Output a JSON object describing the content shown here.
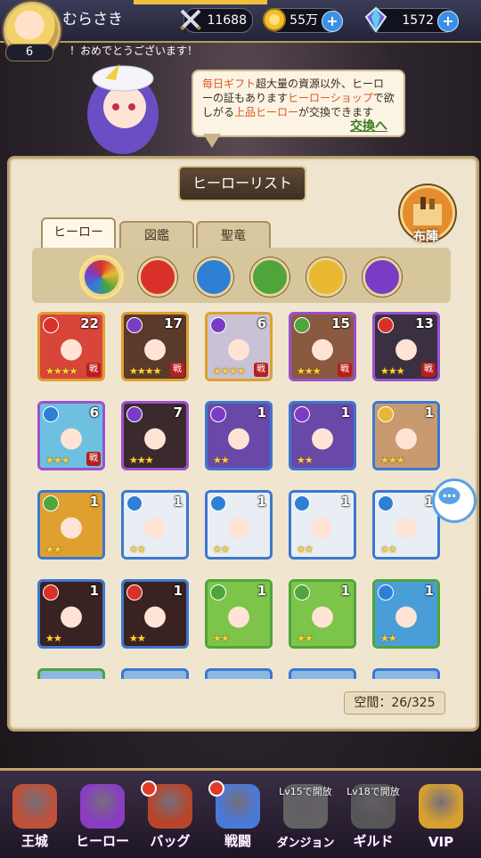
{
  "player": {
    "name": "むらさき",
    "level": "6",
    "power": "11688",
    "gold": "55万",
    "gems": "1572",
    "notice": "！おめでとうございます！"
  },
  "bubble": {
    "part1": "毎日ギフト",
    "part2": "超大量の資源以外、ヒーローの証もあります",
    "part3": "ヒーローショップ",
    "part4": "で欲しがる",
    "part5": "上品ヒーロー",
    "part6": "が交換できます",
    "link": "交換へ"
  },
  "panel": {
    "title": "ヒーローリスト",
    "tabs": [
      "ヒーロー",
      "図鑑",
      "聖竜"
    ],
    "formation": "布陣",
    "space": "空間：26/325"
  },
  "colors": {
    "accent": "#b9a172",
    "gold_star": "#ffd23a",
    "fire": "#d9302a",
    "water": "#2e7fd6",
    "wood": "#4fa43a",
    "light": "#e8b830",
    "dark": "#7a3cc4"
  },
  "filters": [
    "all",
    "fire",
    "water",
    "wood",
    "light",
    "dark"
  ],
  "heroes": [
    {
      "count": "22",
      "element": "fire",
      "stars": 4,
      "badge": "戦",
      "frame": "#e0a030",
      "art": "#d8463a"
    },
    {
      "count": "17",
      "element": "dark",
      "stars": 4,
      "badge": "戦",
      "frame": "#e0a030",
      "art": "#5a3a2a"
    },
    {
      "count": "6",
      "element": "dark",
      "stars": 4,
      "badge": "戦",
      "frame": "#e0a030",
      "art": "#c9c2d6"
    },
    {
      "count": "15",
      "element": "wood",
      "stars": 3,
      "badge": "戦",
      "frame": "#9b4fd0",
      "art": "#8a5a40"
    },
    {
      "count": "13",
      "element": "fire",
      "stars": 3,
      "badge": "戦",
      "frame": "#9b4fd0",
      "art": "#3a3040"
    },
    {
      "count": "6",
      "element": "water",
      "stars": 3,
      "badge": "戦",
      "frame": "#9b4fd0",
      "art": "#6ec0e0"
    },
    {
      "count": "7",
      "element": "dark",
      "stars": 3,
      "badge": "",
      "frame": "#9b4fd0",
      "art": "#3a2a2e"
    },
    {
      "count": "1",
      "element": "dark",
      "stars": 2,
      "badge": "",
      "frame": "#3b78d0",
      "art": "#6a48a8"
    },
    {
      "count": "1",
      "element": "dark",
      "stars": 2,
      "badge": "",
      "frame": "#3b78d0",
      "art": "#6a48a8"
    },
    {
      "count": "1",
      "element": "light",
      "stars": 3,
      "badge": "",
      "frame": "#3b78d0",
      "art": "#c89a70"
    },
    {
      "count": "1",
      "element": "wood",
      "stars": 2,
      "badge": "",
      "frame": "#3b78d0",
      "art": "#e0a030"
    },
    {
      "count": "1",
      "element": "water",
      "stars": 2,
      "badge": "",
      "frame": "#3b78d0",
      "art": "#e8eef4"
    },
    {
      "count": "1",
      "element": "water",
      "stars": 2,
      "badge": "",
      "frame": "#3b78d0",
      "art": "#e8eef4"
    },
    {
      "count": "1",
      "element": "water",
      "stars": 2,
      "badge": "",
      "frame": "#3b78d0",
      "art": "#e8eef4"
    },
    {
      "count": "1",
      "element": "water",
      "stars": 2,
      "badge": "",
      "frame": "#3b78d0",
      "art": "#e8eef4"
    },
    {
      "count": "1",
      "element": "fire",
      "stars": 2,
      "badge": "",
      "frame": "#3b78d0",
      "art": "#3a2222"
    },
    {
      "count": "1",
      "element": "fire",
      "stars": 2,
      "badge": "",
      "frame": "#3b78d0",
      "art": "#3a2222"
    },
    {
      "count": "1",
      "element": "wood",
      "stars": 2,
      "badge": "",
      "frame": "#4fa43a",
      "art": "#7cc44a"
    },
    {
      "count": "1",
      "element": "wood",
      "stars": 2,
      "badge": "",
      "frame": "#4fa43a",
      "art": "#7cc44a"
    },
    {
      "count": "1",
      "element": "water",
      "stars": 2,
      "badge": "",
      "frame": "#4fa43a",
      "art": "#4a9ed8"
    }
  ],
  "nav": [
    {
      "label": "王城",
      "lock": "",
      "icon": "castle-icon",
      "color": "#c0503a"
    },
    {
      "label": "ヒーロー",
      "lock": "",
      "icon": "hero-icon",
      "color": "#8a3cc4"
    },
    {
      "label": "バッグ",
      "lock": "",
      "icon": "bag-icon",
      "color": "#b8452a"
    },
    {
      "label": "戦闘",
      "lock": "",
      "icon": "battle-icon",
      "color": "#4a7ad8"
    },
    {
      "label": "ダンジョン",
      "lock": "Lv15で開放",
      "icon": "dungeon-icon",
      "color": "#7a7a88"
    },
    {
      "label": "ギルド",
      "lock": "Lv18で開放",
      "icon": "guild-icon",
      "color": "#6a6a78"
    },
    {
      "label": "VIP",
      "lock": "",
      "icon": "vip-icon",
      "color": "#d8a030"
    }
  ]
}
